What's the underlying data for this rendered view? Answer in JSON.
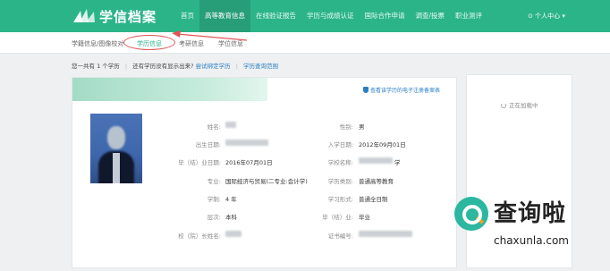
{
  "header": {
    "logo_text": "学信档案",
    "nav": [
      {
        "label": "首页",
        "active": false
      },
      {
        "label": "高等教育信息",
        "active": true
      },
      {
        "label": "在线验证报告",
        "active": false
      },
      {
        "label": "学历与成绩认证",
        "active": false
      },
      {
        "label": "国际合作申请",
        "active": false
      },
      {
        "label": "调查/投票",
        "active": false
      },
      {
        "label": "职业测评",
        "active": false
      }
    ],
    "user_menu": "⊙ 个人中心 ▾"
  },
  "subnav": {
    "items": [
      {
        "label": "学籍信息/图像校对",
        "active": false
      },
      {
        "label": "学历信息",
        "active": true
      },
      {
        "label": "考研信息",
        "active": false
      },
      {
        "label": "学位信息",
        "active": false
      }
    ]
  },
  "info_line": {
    "count_text": "您一共有 1 个学历",
    "missing_text": "还有学历没有显示出来?",
    "bind_link": "尝试绑定学历",
    "scope_link": "学历查询范围"
  },
  "card": {
    "top_link": "查看该学历的电子注册备案表",
    "left_fields": [
      {
        "label": "姓名:",
        "value": ""
      },
      {
        "label": "出生日期:",
        "value": ""
      },
      {
        "label": "毕（结）业日期:",
        "value": "2016年07月01日"
      },
      {
        "label": "专业:",
        "value": "国际经济与贸易(二专业:会计学)"
      },
      {
        "label": "学制:",
        "value": "4 年"
      },
      {
        "label": "层次:",
        "value": "本科"
      },
      {
        "label": "校（院）长姓名:",
        "value": ""
      }
    ],
    "right_fields": [
      {
        "label": "性别:",
        "value": "男"
      },
      {
        "label": "入学日期:",
        "value": "2012年09月01日"
      },
      {
        "label": "学校名称:",
        "value": "学"
      },
      {
        "label": "学历类别:",
        "value": "普通高等教育"
      },
      {
        "label": "学习形式:",
        "value": "普通全日制"
      },
      {
        "label": "毕（结）业:",
        "value": "毕业"
      },
      {
        "label": "证书编号:",
        "value": ""
      }
    ]
  },
  "side": {
    "loading_text": "正在加载中"
  },
  "watermark": {
    "title": "查询啦",
    "sub": "chaxunla.com"
  },
  "colors": {
    "brand_green": "#2cb489",
    "link_blue": "#2a7fc4",
    "annotation_red": "#e05555"
  }
}
